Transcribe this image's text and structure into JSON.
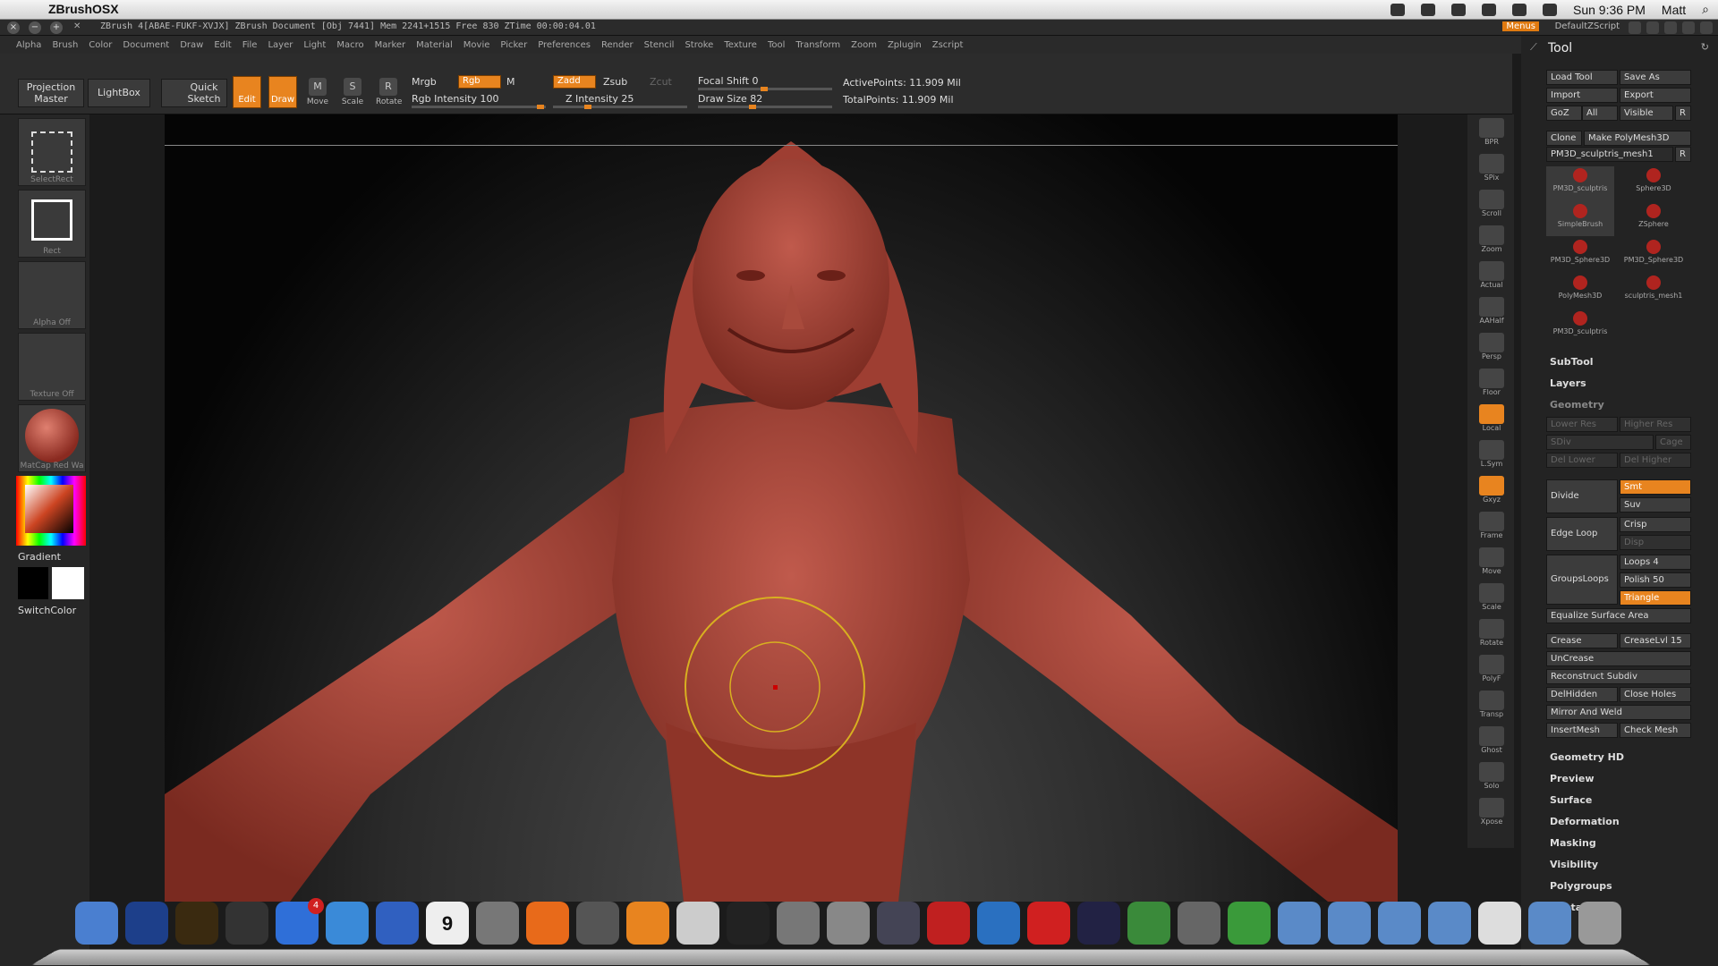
{
  "menubar": {
    "app": "ZBrushOSX",
    "clock": "Sun 9:36 PM",
    "user": "Matt"
  },
  "titlebar": {
    "info": "ZBrush 4[ABAE-FUKF-XVJX]   ZBrush Document   [Obj 7441]  Mem 2241+1515  Free 830  ZTime 00:00:04.01",
    "menus": "Menus",
    "script": "DefaultZScript"
  },
  "zmenu": [
    "Alpha",
    "Brush",
    "Color",
    "Document",
    "Draw",
    "Edit",
    "File",
    "Layer",
    "Light",
    "Macro",
    "Marker",
    "Material",
    "Movie",
    "Picker",
    "Preferences",
    "Render",
    "Stencil",
    "Stroke",
    "Texture",
    "Tool",
    "Transform",
    "Zoom",
    "Zplugin",
    "Zscript"
  ],
  "shelf": {
    "projection": "Projection Master",
    "lightbox": "LightBox",
    "quicksketch": "Quick Sketch",
    "edit": "Edit",
    "draw": "Draw",
    "move": "Move",
    "scale": "Scale",
    "rotate": "Rotate",
    "mrgb": "Mrgb",
    "rgb": "Rgb",
    "m": "M",
    "zadd": "Zadd",
    "zsub": "Zsub",
    "zcut": "Zcut",
    "rgb_intensity": "Rgb Intensity 100",
    "z_intensity": "Z Intensity 25",
    "focal": "Focal Shift 0",
    "drawsize": "Draw Size 82",
    "active": "ActivePoints: 11.909 Mil",
    "total": "TotalPoints: 11.909 Mil",
    "rgb_intensity_value": 100,
    "z_intensity_value": 25,
    "focal_value": 0,
    "drawsize_value": 82
  },
  "left": {
    "selectrect": "SelectRect",
    "rect": "Rect",
    "alpha": "Alpha  Off",
    "texture": "Texture  Off",
    "matcap": "MatCap Red Wa",
    "gradient": "Gradient",
    "switch": "SwitchColor"
  },
  "right": [
    "BPR",
    "SPix",
    "Scroll",
    "Zoom",
    "Actual",
    "AAHalf",
    "Persp",
    "Floor",
    "Local",
    "L.Sym",
    "Gxyz",
    "Frame",
    "Move",
    "Scale",
    "Rotate",
    "PolyF",
    "Transp",
    "Ghost",
    "Solo",
    "Xpose"
  ],
  "tool": {
    "title": "Tool",
    "load": "Load Tool",
    "saveas": "Save As",
    "import": "Import",
    "export": "Export",
    "goz": "GoZ",
    "all": "All",
    "visible": "Visible",
    "r": "R",
    "clone": "Clone",
    "makepoly": "Make PolyMesh3D",
    "current": "PM3D_sculptris_mesh1",
    "thumbs": [
      "PM3D_sculptris",
      "Sphere3D",
      "SimpleBrush",
      "ZSphere",
      "PM3D_Sphere3D",
      "PM3D_Sphere3D",
      "PolyMesh3D",
      "sculptris_mesh1",
      "PM3D_sculptris"
    ],
    "subtool": "SubTool",
    "layers": "Layers",
    "geometry": "Geometry",
    "lowerres": "Lower Res",
    "higherres": "Higher Res",
    "sdiv": "SDiv",
    "cage": "Cage",
    "dellower": "Del Lower",
    "delhigher": "Del Higher",
    "divide": "Divide",
    "smt": "Smt",
    "suv": "Suv",
    "edgeloop": "Edge Loop",
    "crisp": "Crisp",
    "disp": "Disp",
    "groupsloops": "GroupsLoops",
    "loops": "Loops 4",
    "polish": "Polish 50",
    "triangle": "Triangle",
    "equalize": "Equalize Surface Area",
    "crease": "Crease",
    "creaselvl": "CreaseLvl 15",
    "uncrease": "UnCrease",
    "reconstruct": "Reconstruct Subdiv",
    "delhidden": "DelHidden",
    "closeholes": "Close Holes",
    "mirror": "Mirror And Weld",
    "insertmesh": "InsertMesh",
    "checkmesh": "Check Mesh",
    "sections": [
      "Geometry HD",
      "Preview",
      "Surface",
      "Deformation",
      "Masking",
      "Visibility",
      "Polygroups",
      "Contact"
    ]
  },
  "colors": {
    "accent": "#e8841f",
    "clay": "#b0463a",
    "bg": "#2c2c2c"
  },
  "dock": [
    "finder-icon",
    "photoshop-icon",
    "bridge-icon",
    "dashboard-icon",
    "appstore-icon",
    "safari-icon",
    "itunes-icon",
    "ical-icon",
    "preview-icon",
    "firefox-icon",
    "imagecapture-icon",
    "blender-icon",
    "script-editor-icon",
    "skype-icon",
    "zbrush-icon",
    "eye-icon",
    "timemachine-icon",
    "k-icon",
    "wacom-icon",
    "app-icon",
    "camera-icon",
    "evernote-icon",
    "sysprefs-icon",
    "app2-icon",
    "folder-icon",
    "folder-icon",
    "folder-icon",
    "folder-icon",
    "doc-icon",
    "folder-icon",
    "trash-icon"
  ],
  "dock_badge": "4",
  "ical_day": "9"
}
